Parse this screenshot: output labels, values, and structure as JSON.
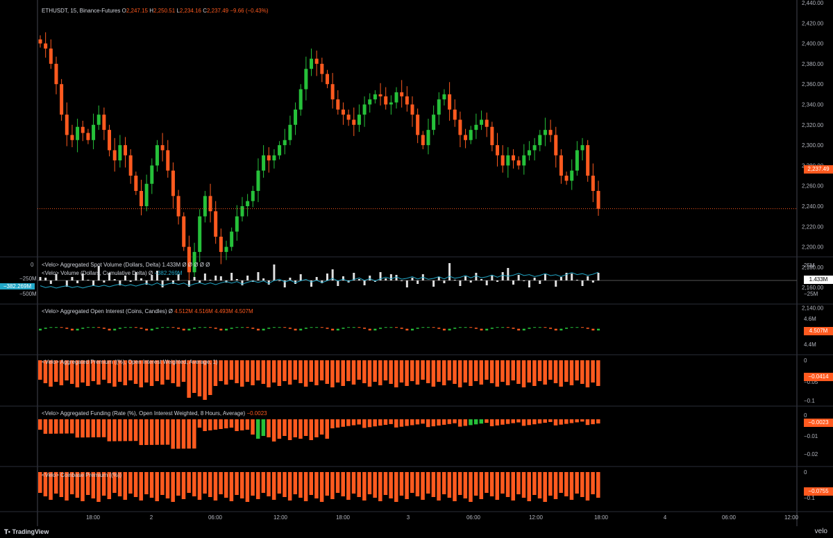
{
  "symbol": {
    "name": "ETHUSDT, 15, Binance-Futures",
    "o_label": "O",
    "o_val": "2,247.15",
    "h_label": "H",
    "h_val": "2,250.51",
    "l_label": "L",
    "l_val": "2,234.16",
    "c_label": "C",
    "c_val": "2,237.49",
    "change": "−9.66 (−0.43%)",
    "last_price": "2,237.49"
  },
  "colors": {
    "up": "#26c13a",
    "down": "#ff5a1f",
    "cyan": "#22a7c7",
    "background": "#000000"
  },
  "price_axis": [
    "2,440.00",
    "2,420.00",
    "2,400.00",
    "2,380.00",
    "2,360.00",
    "2,340.00",
    "2,320.00",
    "2,300.00",
    "2,280.00",
    "2,260.00",
    "2,240.00",
    "2,220.00",
    "2,200.00",
    "2,180.00",
    "2,160.00",
    "2,140.00"
  ],
  "time_axis": [
    "18:00",
    "2",
    "06:00",
    "12:00",
    "18:00",
    "3",
    "06:00",
    "12:00",
    "18:00",
    "4",
    "06:00",
    "12:00"
  ],
  "panes": {
    "volume": {
      "title1": "<Velo> Aggregated Spot Volume (Dollars, Delta)",
      "title1_vals": "1.433M  Ø  Ø  Ø  Ø  Ø",
      "title2": "<Velo> Volume (Dollars, Cumulative Delta)  Ø",
      "title2_val": "−382.269M",
      "left_axis": [
        "0",
        "−250M",
        "−382.269M",
        "−500M"
      ],
      "right_axis": [
        "25M",
        "−25M"
      ],
      "tag": "1.433M"
    },
    "oi": {
      "title": "<Velo> Aggregated Open Interest (Coins, Candles)  Ø",
      "vals": "4.512M  4.516M  4.493M  4.507M",
      "right_axis": [
        "4.6M",
        "4.4M"
      ],
      "tag": "4.507M"
    },
    "premium": {
      "title": "<Velo> Aggregated Premium ((%), Open Interest Weighted, Average, 1)",
      "right_axis": [
        "0",
        "−0.05",
        "−0.1"
      ],
      "tag": "−0.0414"
    },
    "funding": {
      "title": "<Velo> Aggregated Funding (Rate (%), Open Interest Weighted, 8 Hours, Average)",
      "val": "−0.0023",
      "right_axis": [
        "0",
        "−0.01",
        "−0.02"
      ],
      "tag": "−0.0023"
    },
    "cbpremium": {
      "title": "<Velo> Coinbase Premium ((%))",
      "right_axis": [
        "0",
        "−0.1"
      ],
      "tag": "−0.0755"
    }
  },
  "footer": {
    "logo": "TradingView",
    "brand": "velo"
  },
  "chart_data": [
    {
      "type": "candlestick",
      "title": "ETHUSDT, 15, Binance-Futures",
      "x_ticks": [
        "18:00",
        "2",
        "06:00",
        "12:00",
        "18:00",
        "3",
        "06:00",
        "12:00",
        "18:00"
      ],
      "ylim": [
        2140,
        2440
      ],
      "close_approx": [
        2400,
        2395,
        2380,
        2360,
        2330,
        2310,
        2305,
        2318,
        2312,
        2305,
        2320,
        2330,
        2315,
        2295,
        2285,
        2300,
        2290,
        2270,
        2255,
        2240,
        2262,
        2280,
        2300,
        2295,
        2275,
        2250,
        2230,
        2200,
        2175,
        2195,
        2230,
        2250,
        2235,
        2210,
        2195,
        2200,
        2215,
        2230,
        2240,
        2245,
        2255,
        2275,
        2290,
        2285,
        2290,
        2300,
        2305,
        2320,
        2335,
        2355,
        2375,
        2385,
        2380,
        2370,
        2360,
        2345,
        2335,
        2330,
        2325,
        2320,
        2330,
        2340,
        2345,
        2350,
        2348,
        2340,
        2342,
        2352,
        2348,
        2340,
        2330,
        2310,
        2300,
        2315,
        2330,
        2345,
        2350,
        2335,
        2325,
        2310,
        2305,
        2315,
        2320,
        2325,
        2318,
        2300,
        2290,
        2280,
        2290,
        2285,
        2280,
        2290,
        2295,
        2300,
        2310,
        2315,
        2310,
        2290,
        2270,
        2265,
        2275,
        2295,
        2300,
        2270,
        2255,
        2237.49
      ],
      "last": 2237.49
    },
    {
      "type": "bar",
      "title": "<Velo> Aggregated Spot Volume (Dollars, Delta)",
      "last_value": "1.433M",
      "cumulative_delta_last": "−382.269M",
      "ylim": [
        -25,
        25
      ]
    },
    {
      "type": "candlestick",
      "title": "<Velo> Aggregated Open Interest (Coins, Candles)",
      "last_value": "4.507M",
      "y_ticks": [
        "4.6M",
        "4.4M"
      ]
    },
    {
      "type": "bar",
      "title": "<Velo> Aggregated Premium ((%), Open Interest Weighted, Average, 1)",
      "last_value": -0.0414,
      "ylim": [
        -0.1,
        0
      ]
    },
    {
      "type": "bar",
      "title": "<Velo> Aggregated Funding (Rate (%), Open Interest Weighted, 8 Hours, Average)",
      "last_value": -0.0023,
      "ylim": [
        -0.02,
        0
      ]
    },
    {
      "type": "bar",
      "title": "<Velo> Coinbase Premium ((%))",
      "last_value": -0.0755,
      "ylim": [
        -0.1,
        0
      ]
    }
  ]
}
